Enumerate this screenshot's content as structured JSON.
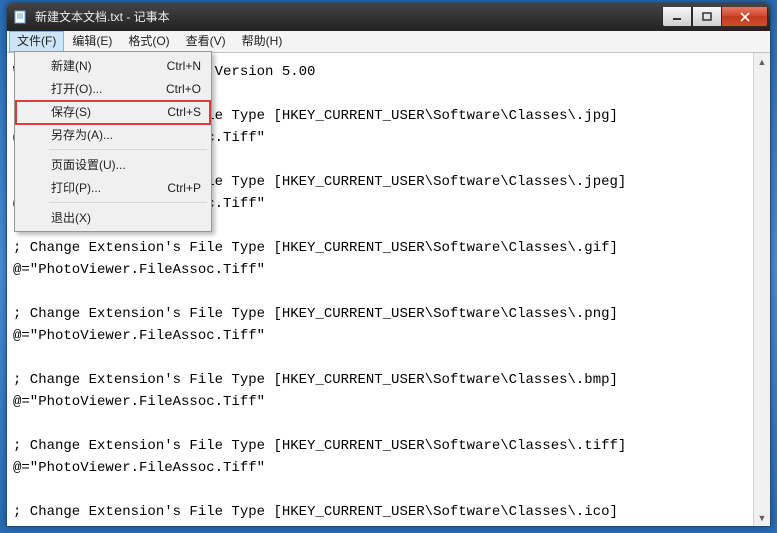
{
  "window": {
    "title": "新建文本文档.txt - 记事本"
  },
  "menubar": {
    "file": "文件(F)",
    "edit": "编辑(E)",
    "format": "格式(O)",
    "view": "查看(V)",
    "help": "帮助(H)"
  },
  "dropdown": {
    "new": {
      "label": "新建(N)",
      "shortcut": "Ctrl+N"
    },
    "open": {
      "label": "打开(O)...",
      "shortcut": "Ctrl+O"
    },
    "save": {
      "label": "保存(S)",
      "shortcut": "Ctrl+S"
    },
    "saveas": {
      "label": "另存为(A)...",
      "shortcut": ""
    },
    "pagesetup": {
      "label": "页面设置(U)...",
      "shortcut": ""
    },
    "print": {
      "label": "打印(P)...",
      "shortcut": "Ctrl+P"
    },
    "exit": {
      "label": "退出(X)",
      "shortcut": ""
    }
  },
  "content": "Windows Registry Editor Version 5.00\n\n; Change Extension's File Type [HKEY_CURRENT_USER\\Software\\Classes\\.jpg]\n@=\"PhotoViewer.FileAssoc.Tiff\"\n\n; Change Extension's File Type [HKEY_CURRENT_USER\\Software\\Classes\\.jpeg]\n@=\"PhotoViewer.FileAssoc.Tiff\"\n\n; Change Extension's File Type [HKEY_CURRENT_USER\\Software\\Classes\\.gif]\n@=\"PhotoViewer.FileAssoc.Tiff\"\n\n; Change Extension's File Type [HKEY_CURRENT_USER\\Software\\Classes\\.png]\n@=\"PhotoViewer.FileAssoc.Tiff\"\n\n; Change Extension's File Type [HKEY_CURRENT_USER\\Software\\Classes\\.bmp]\n@=\"PhotoViewer.FileAssoc.Tiff\"\n\n; Change Extension's File Type [HKEY_CURRENT_USER\\Software\\Classes\\.tiff]\n@=\"PhotoViewer.FileAssoc.Tiff\"\n\n; Change Extension's File Type [HKEY_CURRENT_USER\\Software\\Classes\\.ico]\n@=\"PhotoViewer.FileAssoc.Tiff\"\n"
}
